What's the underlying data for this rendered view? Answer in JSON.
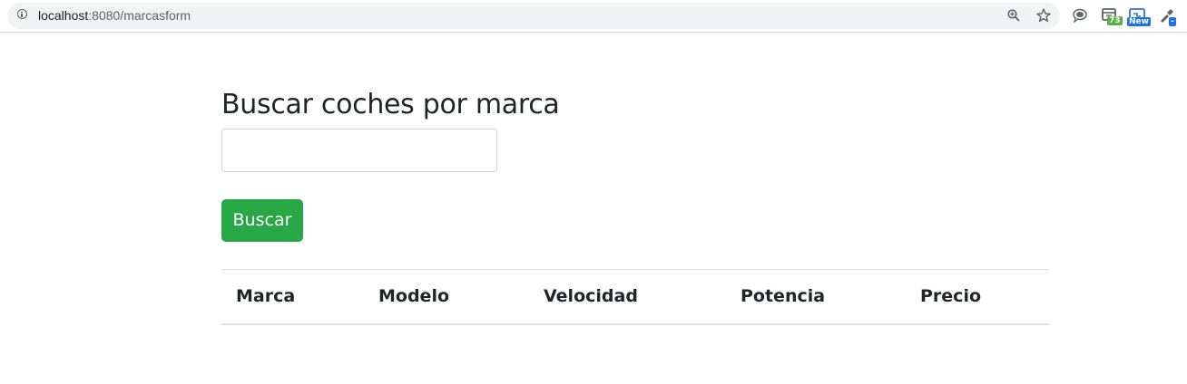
{
  "browser": {
    "url_host": "localhost",
    "url_path": ":8080/marcasform",
    "extension_badges": [
      "73",
      "New",
      "-"
    ]
  },
  "page": {
    "title": "Buscar coches por marca",
    "search": {
      "value": "",
      "placeholder": ""
    },
    "search_button_label": "Buscar",
    "table": {
      "headers": [
        "Marca",
        "Modelo",
        "Velocidad",
        "Potencia",
        "Precio"
      ]
    }
  },
  "colors": {
    "button_bg": "#28a745",
    "text": "#212529",
    "border": "#dee2e6"
  }
}
